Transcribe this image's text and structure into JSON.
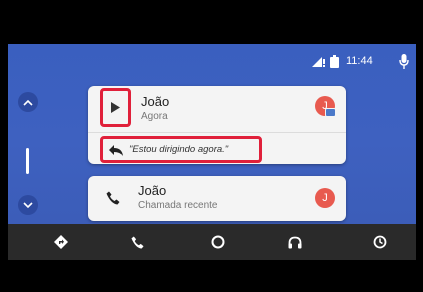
{
  "status": {
    "time": "11:44",
    "icons": [
      "signal-icon",
      "battery-icon",
      "mic-icon"
    ]
  },
  "rail": {
    "icons": [
      "chevron-up-icon",
      "scroll-bar",
      "chevron-down-icon"
    ]
  },
  "message_card": {
    "contact_name": "João",
    "subtitle": "Agora",
    "avatar_initial": "J",
    "reply_text": "\"Estou dirigindo agora.\"",
    "icons": [
      "play-icon",
      "reply-icon",
      "message-badge-icon"
    ]
  },
  "call_card": {
    "contact_name": "João",
    "subtitle": "Chamada recente",
    "avatar_initial": "J",
    "icons": [
      "phone-icon"
    ]
  },
  "nav": {
    "items": [
      "maps-icon",
      "phone-icon",
      "home-icon",
      "headphones-icon",
      "recent-icon"
    ]
  },
  "colors": {
    "background": "#3e61c0",
    "card": "#f4f4f4",
    "avatar": "#e85a4f",
    "highlight": "#e0203a",
    "navbar": "#2a2a2a"
  }
}
